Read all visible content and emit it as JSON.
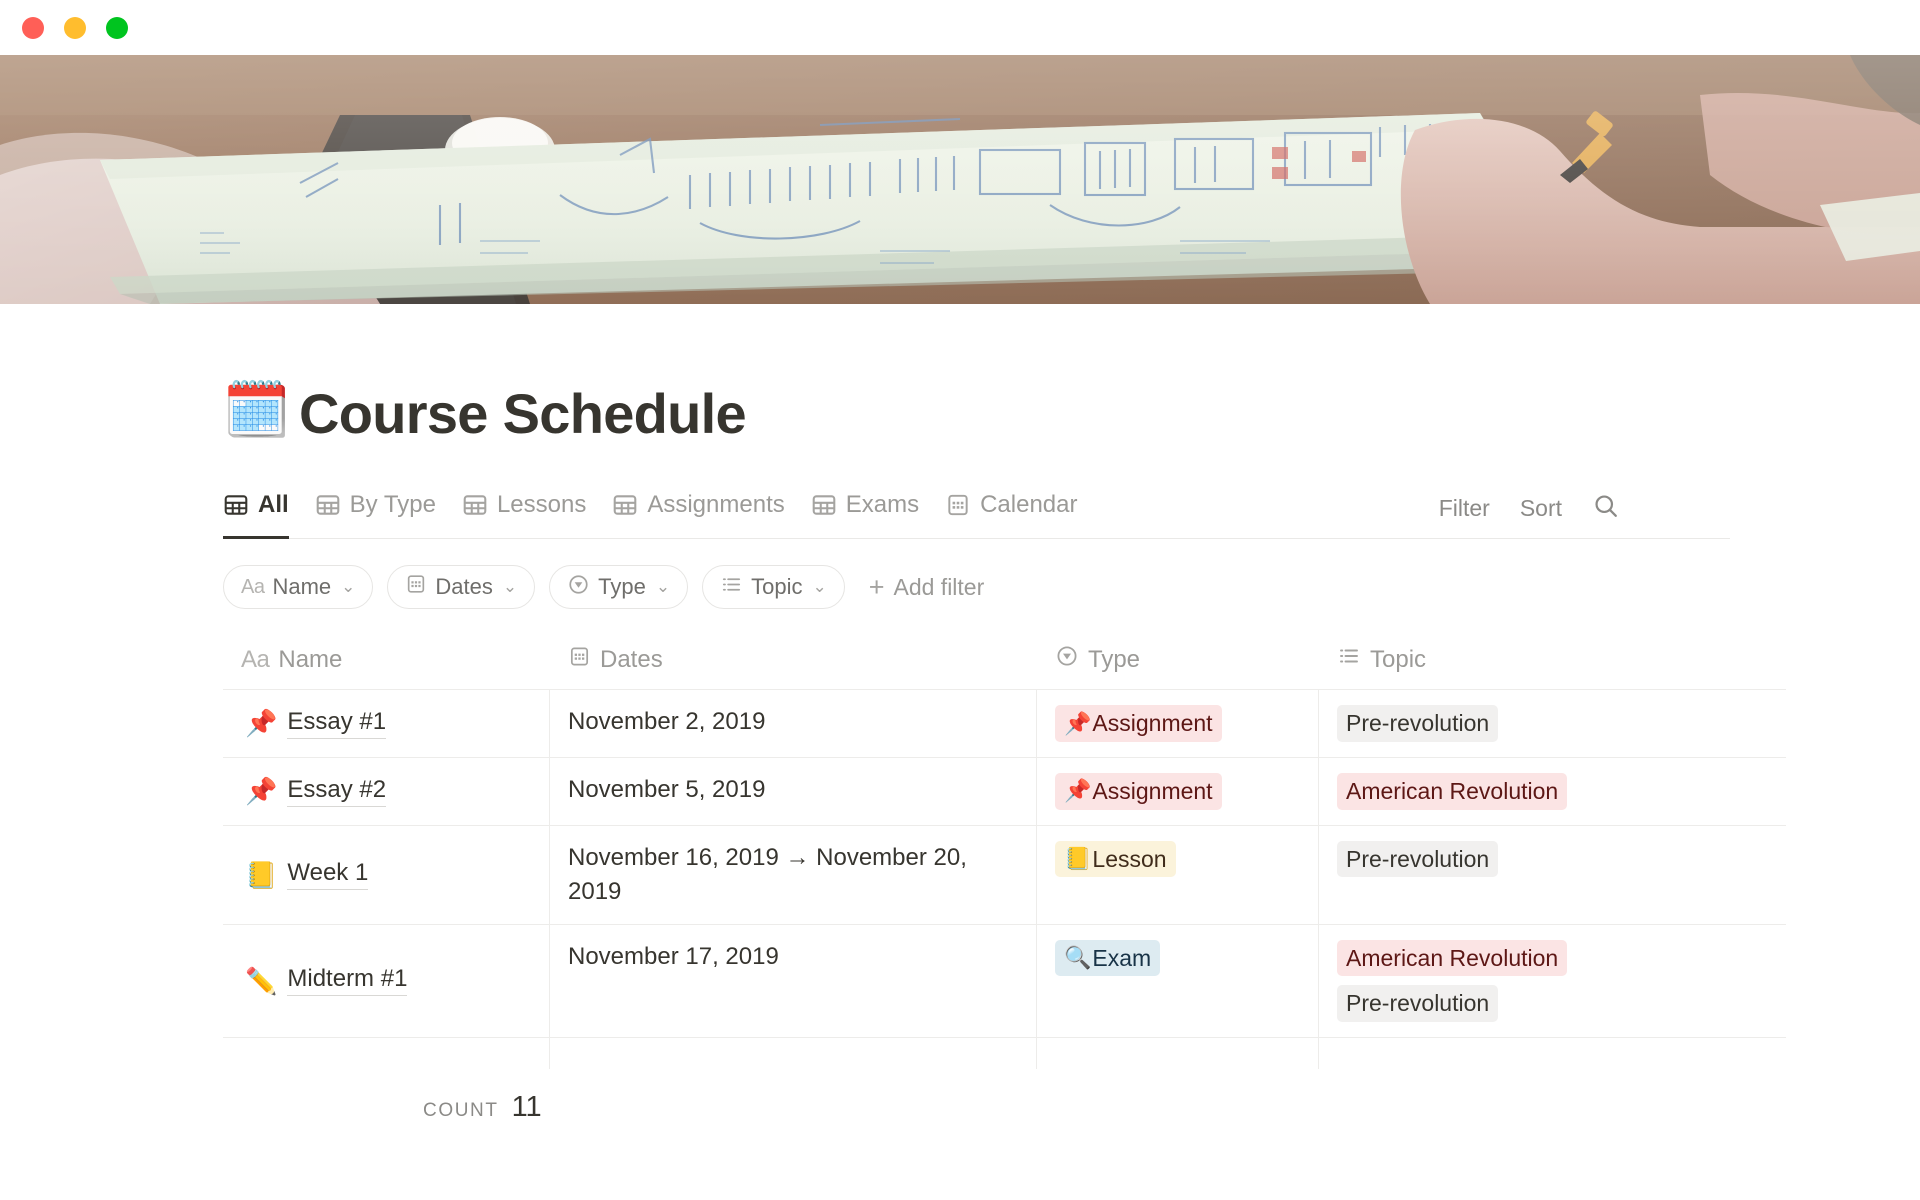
{
  "window": {
    "traffic_lights": [
      {
        "name": "close",
        "color": "#FF5F57"
      },
      {
        "name": "minimize",
        "color": "#FFBD2E"
      },
      {
        "name": "zoom",
        "color": "#00C41F"
      }
    ]
  },
  "cover": {
    "alt": "Overhead photo of hands sketching diagrams in an open notebook on a wooden desk"
  },
  "header": {
    "emoji": "🗓️",
    "emoji_name": "spiral-calendar-emoji",
    "title": "Course Schedule"
  },
  "tabs": [
    {
      "label": "All",
      "icon": "table-icon",
      "active": true
    },
    {
      "label": "By Type",
      "icon": "table-icon",
      "active": false
    },
    {
      "label": "Lessons",
      "icon": "table-icon",
      "active": false
    },
    {
      "label": "Assignments",
      "icon": "table-icon",
      "active": false
    },
    {
      "label": "Exams",
      "icon": "table-icon",
      "active": false
    },
    {
      "label": "Calendar",
      "icon": "calendar-icon",
      "active": false
    }
  ],
  "toolbar": {
    "filter_label": "Filter",
    "sort_label": "Sort",
    "search_icon": "search-icon"
  },
  "filter_chips": [
    {
      "label": "Name",
      "icon": "aa-text-icon",
      "chevron": "⌄"
    },
    {
      "label": "Dates",
      "icon": "calendar-icon",
      "chevron": "⌄"
    },
    {
      "label": "Type",
      "icon": "select-icon",
      "chevron": "⌄"
    },
    {
      "label": "Topic",
      "icon": "multiselect-icon",
      "chevron": "⌄"
    }
  ],
  "add_filter": {
    "label": "Add filter",
    "icon": "plus-icon"
  },
  "table": {
    "columns": [
      {
        "label": "Name",
        "icon": "aa-text-icon"
      },
      {
        "label": "Dates",
        "icon": "calendar-icon"
      },
      {
        "label": "Type",
        "icon": "select-icon"
      },
      {
        "label": "Topic",
        "icon": "multiselect-icon"
      }
    ],
    "rows": [
      {
        "emoji": "📌",
        "emoji_name": "pushpin-emoji",
        "name": "Essay #1",
        "dates": "November 2, 2019",
        "type": {
          "label": "Assignment",
          "emoji": "📌",
          "style": "tag-assignment"
        },
        "topics": [
          {
            "label": "Pre-revolution",
            "style": "tag-gray"
          }
        ]
      },
      {
        "emoji": "📌",
        "emoji_name": "pushpin-emoji",
        "name": "Essay #2",
        "dates": "November 5, 2019",
        "type": {
          "label": "Assignment",
          "emoji": "📌",
          "style": "tag-assignment"
        },
        "topics": [
          {
            "label": "American Revolution",
            "style": "tag-red"
          }
        ]
      },
      {
        "emoji": "📒",
        "emoji_name": "notebook-emoji",
        "name": "Week 1",
        "dates": "November 16, 2019 → November 20, 2019",
        "type": {
          "label": "Lesson",
          "emoji": "📒",
          "style": "tag-lesson"
        },
        "topics": [
          {
            "label": "Pre-revolution",
            "style": "tag-gray"
          }
        ]
      },
      {
        "emoji": "✏️",
        "emoji_name": "pencil-emoji",
        "name": "Midterm #1",
        "dates": "November 17, 2019",
        "type": {
          "label": "Exam",
          "emoji": "🔍",
          "style": "tag-exam"
        },
        "topics": [
          {
            "label": "American Revolution",
            "style": "tag-red"
          },
          {
            "label": "Pre-revolution",
            "style": "tag-gray"
          }
        ]
      }
    ]
  },
  "footer": {
    "count_label": "COUNT",
    "count_value": "11"
  }
}
